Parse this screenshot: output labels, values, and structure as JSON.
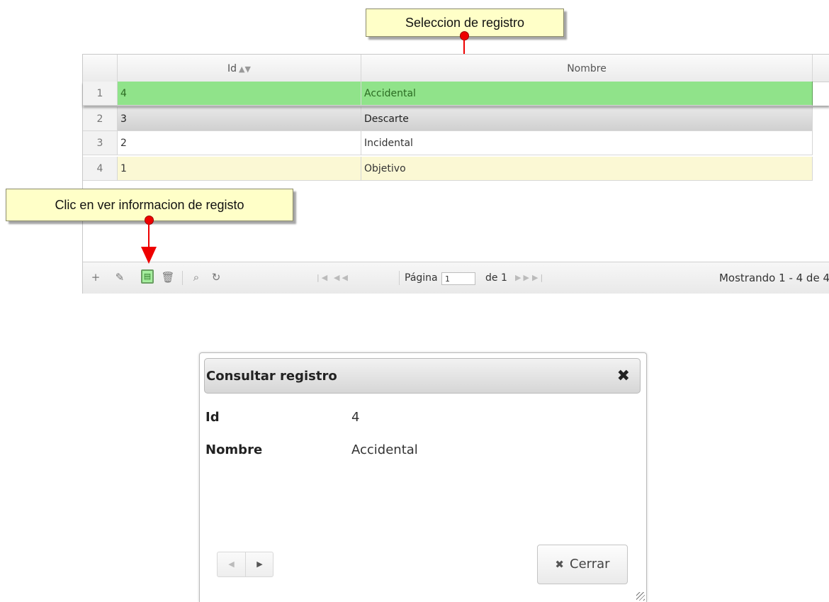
{
  "callouts": {
    "selection": "Seleccion de registro",
    "view_info": "Clic en ver informacion de registo"
  },
  "grid": {
    "columns": {
      "id": "Id",
      "name": "Nombre"
    },
    "sort_icon": "sort-arrows-icon",
    "rows": [
      {
        "num": "1",
        "id": "4",
        "name": "Accidental",
        "state": "selected"
      },
      {
        "num": "2",
        "id": "3",
        "name": "Descarte",
        "state": "hover"
      },
      {
        "num": "3",
        "id": "2",
        "name": "Incidental",
        "state": "normal"
      },
      {
        "num": "4",
        "id": "1",
        "name": "Objetivo",
        "state": "highlight"
      }
    ],
    "footer": {
      "page_label": "Página",
      "page_value": "1",
      "of_label": "de 1",
      "records": "Mostrando 1 - 4 de 4"
    }
  },
  "dialog": {
    "title": "Consultar registro",
    "fields": [
      {
        "label": "Id",
        "value": "4"
      },
      {
        "label": "Nombre",
        "value": "Accidental"
      }
    ],
    "close_label": "Cerrar"
  },
  "colors": {
    "selected_row": "#90e38a",
    "highlight_row": "#fbf8d4",
    "callout_bg": "#ffffc8",
    "pointer": "#ee0000"
  }
}
